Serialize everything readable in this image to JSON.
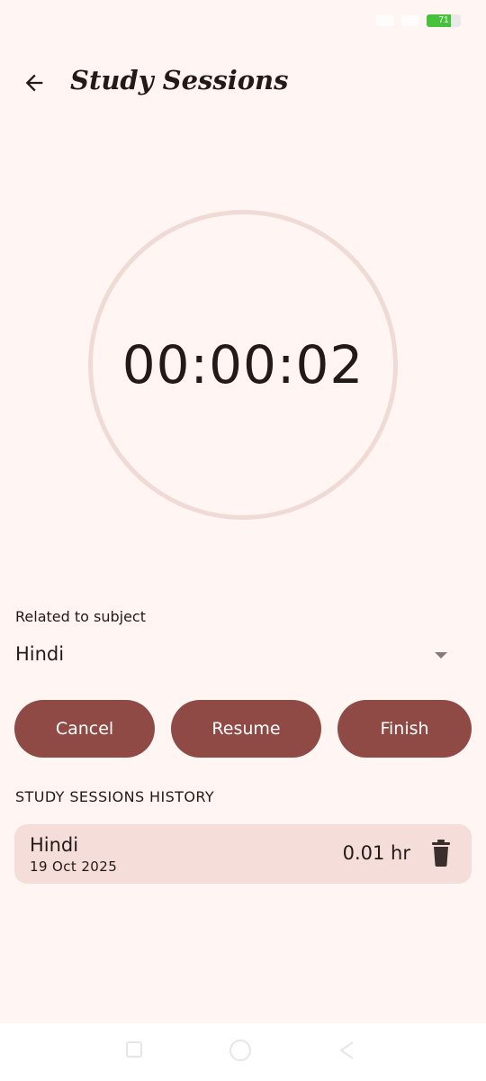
{
  "status_bar": {
    "time": "",
    "battery_level": "71",
    "battery_fill_percent": 71
  },
  "header": {
    "title": "Study Sessions"
  },
  "timer": {
    "elapsed": "00:00:02"
  },
  "subject": {
    "label": "Related to subject",
    "selected": "Hindi"
  },
  "actions": {
    "cancel_label": "Cancel",
    "resume_label": "Resume",
    "finish_label": "Finish"
  },
  "history": {
    "heading": "STUDY SESSIONS HISTORY",
    "sessions": [
      {
        "subject": "Hindi",
        "date": "19 Oct 2025",
        "duration": "0.01 hr"
      }
    ]
  },
  "colors": {
    "background": "#fff5f3",
    "primary_button": "#8f4a45",
    "card": "#f5ddd9",
    "timer_ring": "#f0dad6",
    "battery": "#46c23a"
  },
  "icons": {
    "back": "arrow-back-icon",
    "dropdown": "dropdown-arrow-icon",
    "delete": "trash-icon"
  }
}
